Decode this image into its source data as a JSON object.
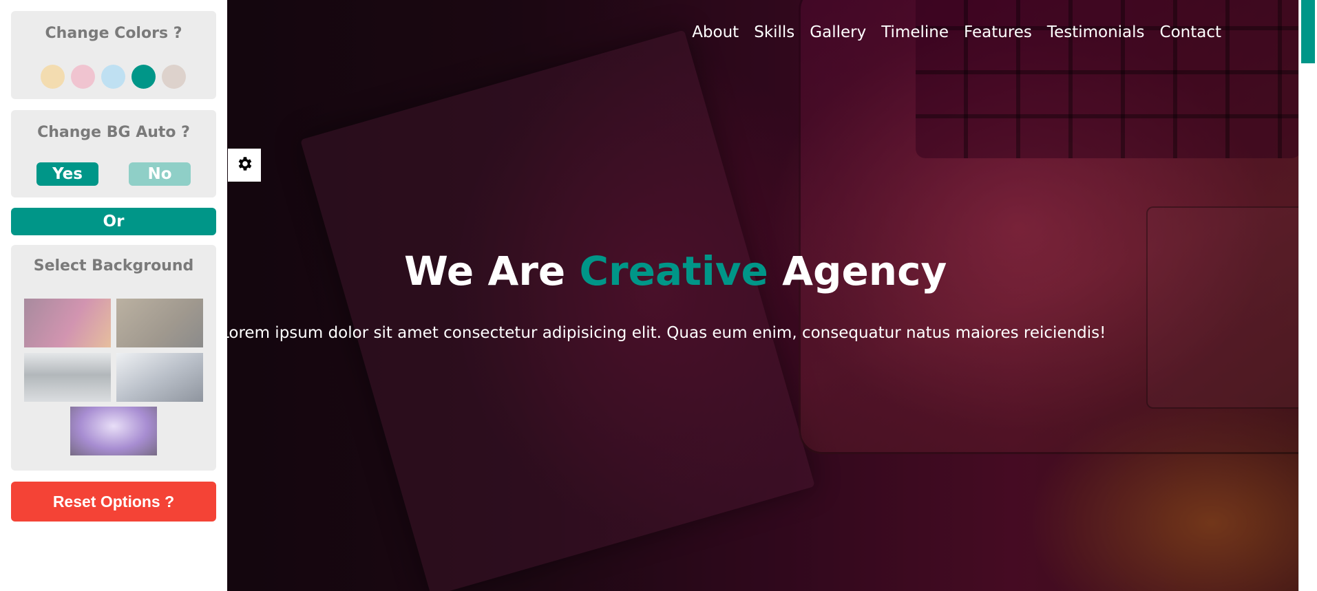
{
  "nav": {
    "items": [
      "About",
      "Skills",
      "Gallery",
      "Timeline",
      "Features",
      "Testimonials",
      "Contact"
    ]
  },
  "hero": {
    "title_prefix": "We Are ",
    "title_accent": "Creative",
    "title_suffix": " Agency",
    "subtitle": "Lorem ipsum dolor sit amet consectetur adipisicing elit. Quas eum enim, consequatur natus maiores reiciendis!"
  },
  "settings": {
    "colors_title": "Change Colors ?",
    "colors": [
      "#f3dcb0",
      "#f0c4d0",
      "#bfe0f2",
      "#009688",
      "#ddd2cc"
    ],
    "active_color": "#009688",
    "bg_auto_title": "Change BG Auto ?",
    "yes_label": "Yes",
    "no_label": "No",
    "or_label": "Or",
    "select_bg_title": "Select Background",
    "backgrounds": [
      "laptop-pink",
      "desk-wood",
      "desk-workspace",
      "keyboard-light",
      "purple-setup"
    ],
    "reset_label": "Reset Options ?"
  },
  "accent_color": "#009688",
  "reset_color": "#f44336"
}
